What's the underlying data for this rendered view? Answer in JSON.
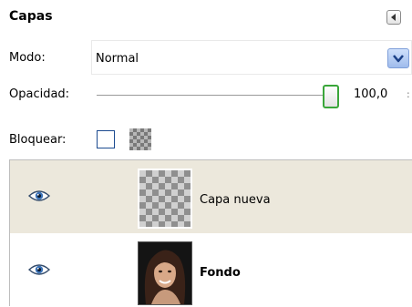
{
  "panel": {
    "title": "Capas"
  },
  "mode": {
    "label": "Modo:",
    "value": "Normal"
  },
  "opacity": {
    "label": "Opacidad:",
    "value_text": "100,0",
    "value": 100.0
  },
  "lock": {
    "label": "Bloquear:",
    "checked": false
  },
  "layers": [
    {
      "name": "Capa nueva",
      "visible": true,
      "selected": true,
      "thumbnail": "transparent-checkerboard"
    },
    {
      "name": "Fondo",
      "visible": true,
      "selected": false,
      "thumbnail": "portrait-photo"
    }
  ],
  "icons": {
    "panel_menu": "panel-menu-icon",
    "dropdown": "chevron-down-icon",
    "visibility": "eye-icon",
    "lock_alpha": "checkerboard-icon"
  },
  "colors": {
    "selected_row": "#ece8dc",
    "slider_handle_border": "#3aa63a",
    "dropdown_button": "#9fbcec"
  }
}
